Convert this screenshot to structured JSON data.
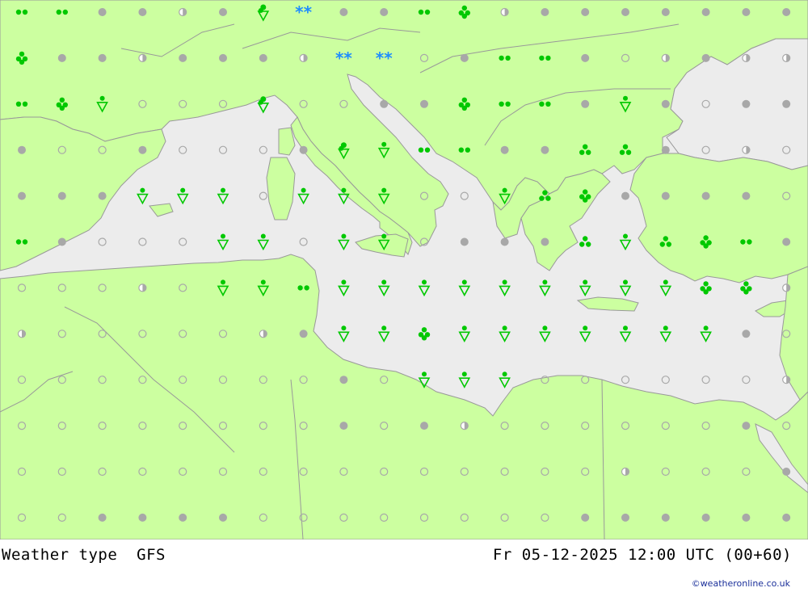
{
  "map": {
    "title": "Weather type",
    "model": "GFS",
    "datetime": "Fr 05-12-2025 12:00 UTC (00+60)",
    "credit": "©weatheronline.co.uk",
    "colors": {
      "land": "#ccff a0",
      "sea": "#ececec",
      "border": "#999999",
      "dry_marker": "#a8a8a8",
      "precip_marker": "#00c800",
      "snow_marker": "#1e8cff"
    },
    "symbol_legend": {
      "O": "clear",
      "H": "half cloudy",
      "C": "overcast",
      "D": "drizzle",
      "R": "rain",
      "M": "heavy rain",
      "S": "showers",
      "T": "rain showers",
      "W": "snow"
    },
    "grid": [
      "DDCCHCTWCCDMHCCCCCCC",
      "MCCHCCCHWWOCDDCOHCHH",
      "DMSOOOTOOCCMDDCSCOCC",
      "COOCOOOCTSDDCCRRCOHO",
      "CCCSSSOSSSOOSRMCCCCO",
      "DCOOOSSOSSOCCCRSRMDC",
      "OOOHOSSDSSSSSSSSSMMH",
      "HOOOOOHCSSMSSSSSSSCO",
      "OOOOOOOOCOSSSOOOOOOH",
      "OOOOOOOOCOCHOOOOOOCO",
      "OOOOOOOOOOOOOOOHOOOC",
      "OOCCCCOOOOOOOOCCCCCC"
    ]
  }
}
